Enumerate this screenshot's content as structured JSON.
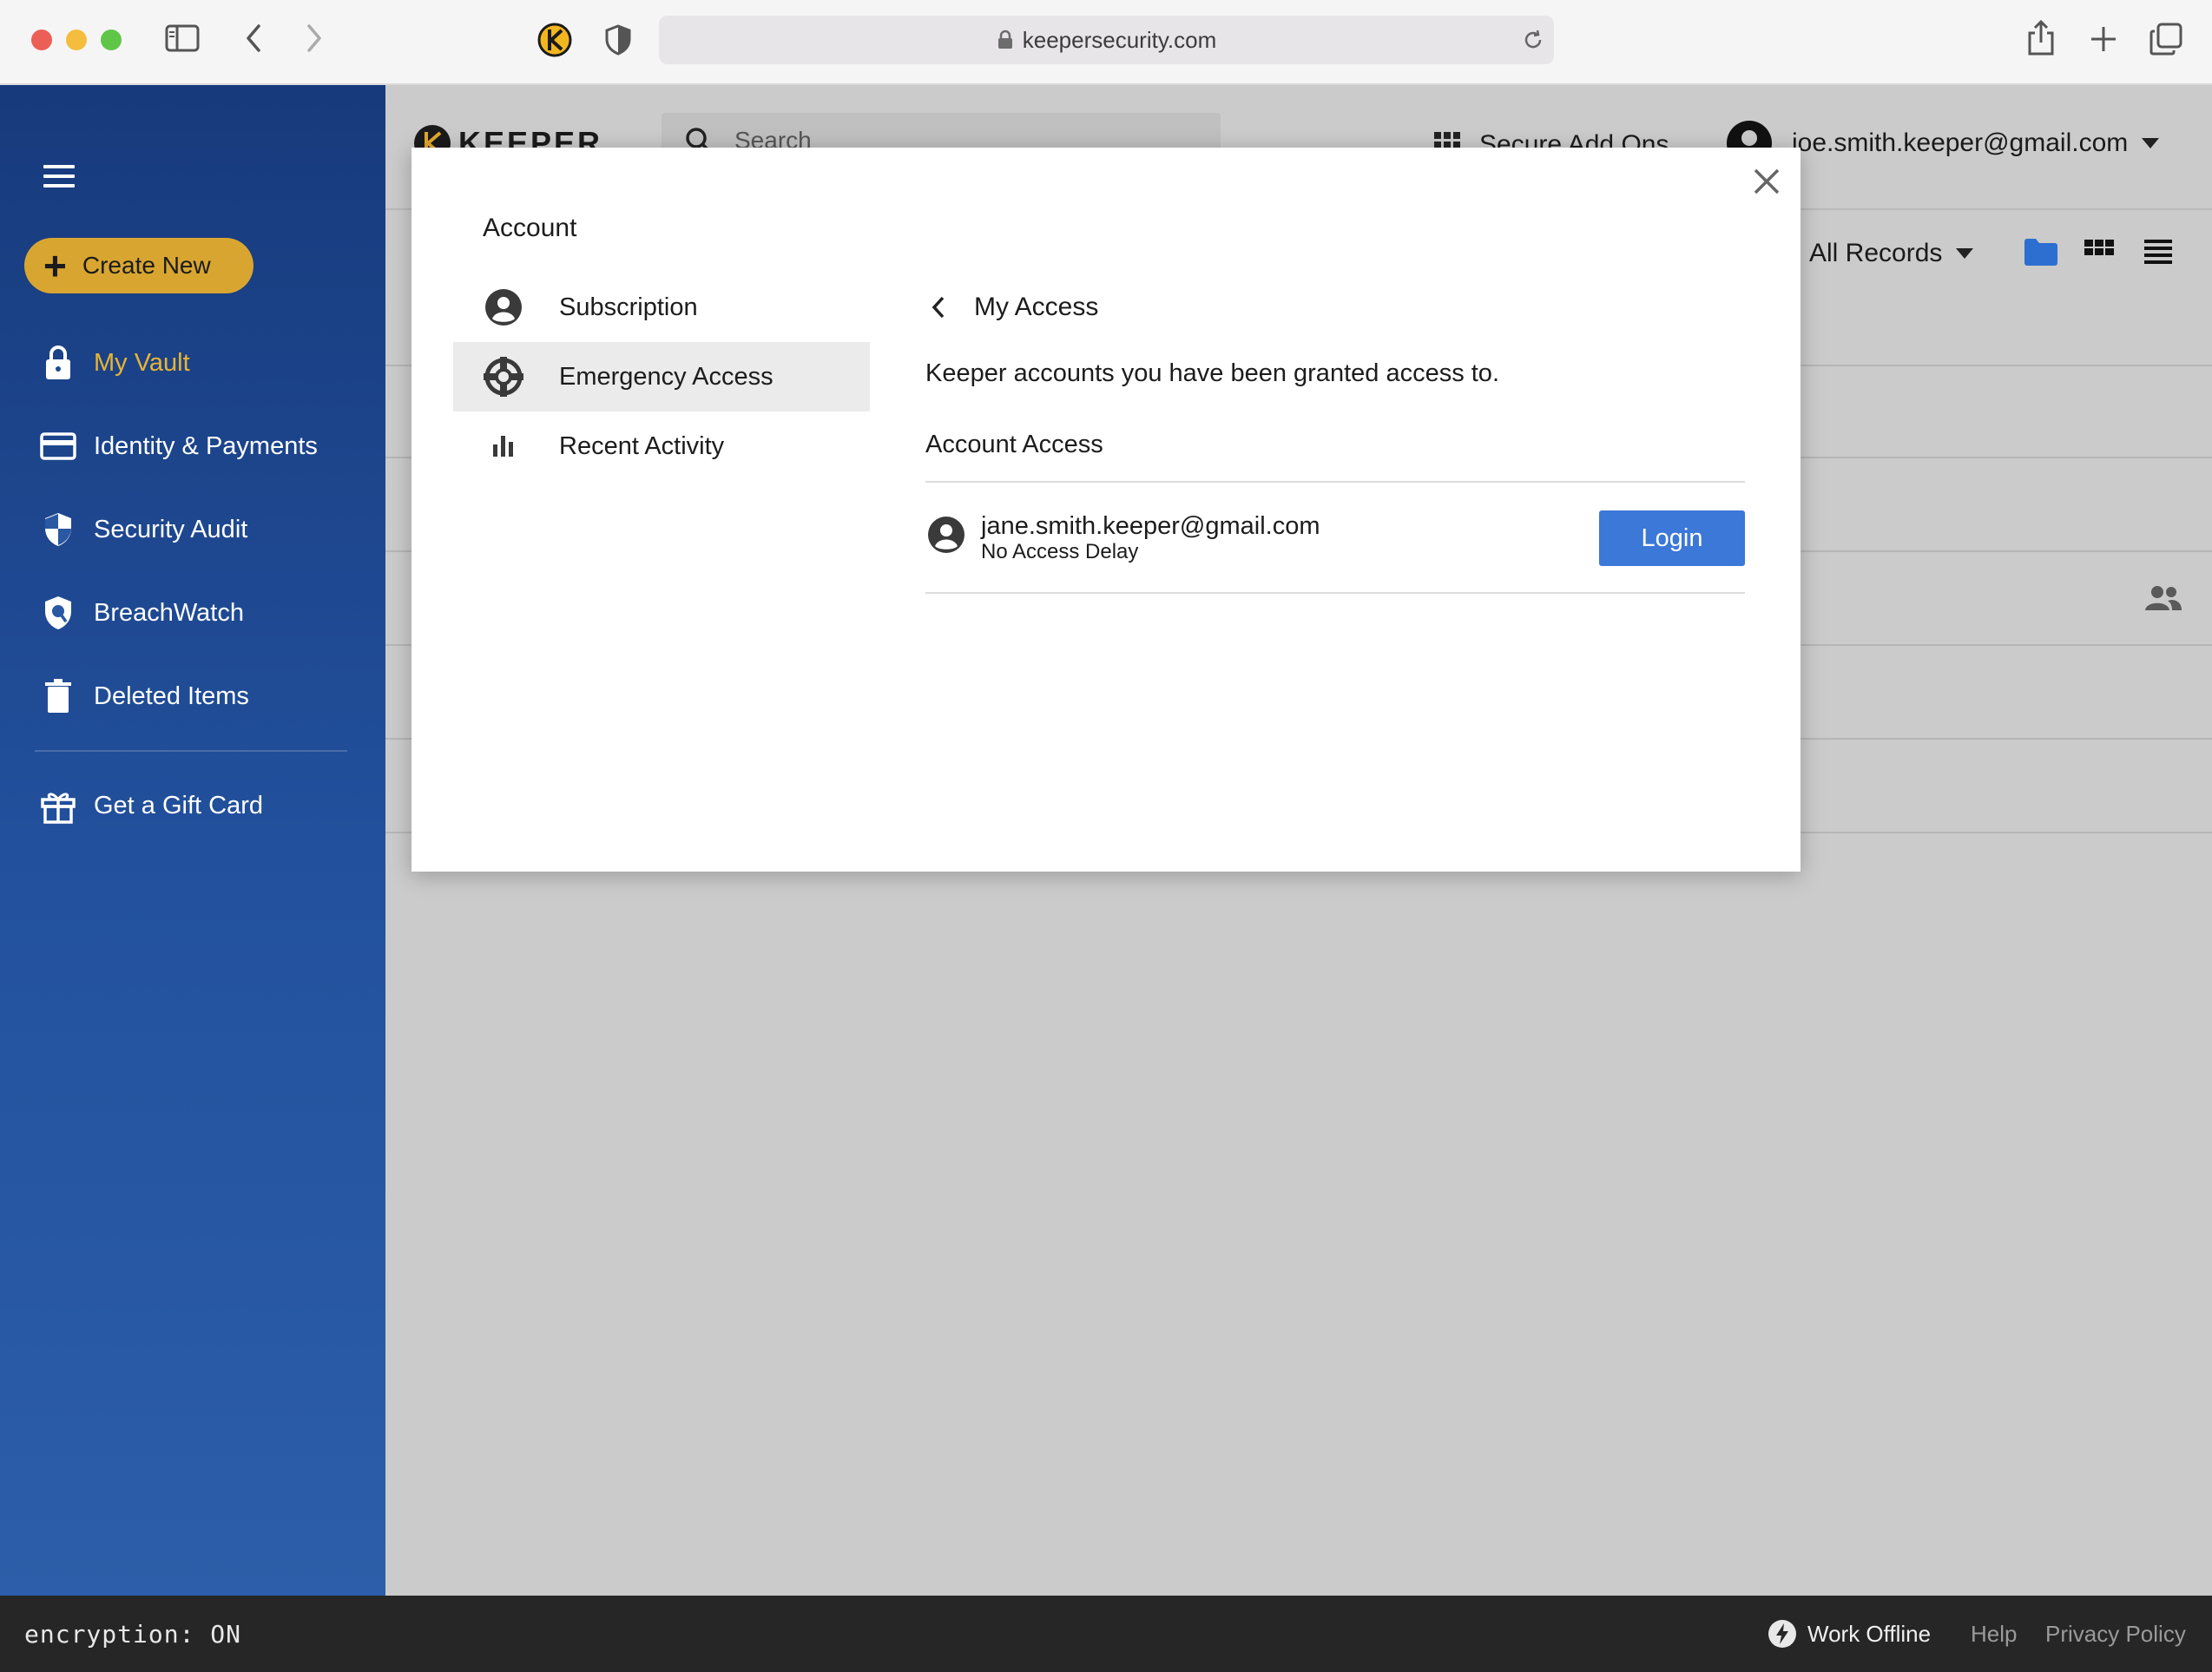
{
  "browser": {
    "url": "keepersecurity.com"
  },
  "sidebar": {
    "create_new": "Create New",
    "items": [
      {
        "label": "My Vault",
        "active": true
      },
      {
        "label": "Identity & Payments"
      },
      {
        "label": "Security Audit"
      },
      {
        "label": "BreachWatch"
      },
      {
        "label": "Deleted Items"
      },
      {
        "label": "Get a Gift Card"
      }
    ]
  },
  "header": {
    "logo_text": "KEEPER",
    "search_placeholder": "Search",
    "secure_addons": "Secure Add Ons",
    "user_email": "joe.smith.keeper@gmail.com",
    "filter": "All Records"
  },
  "modal": {
    "title": "Account",
    "menu": [
      {
        "label": "Subscription",
        "icon": "account-circle-icon"
      },
      {
        "label": "Emergency Access",
        "icon": "lifebuoy-icon",
        "selected": true
      },
      {
        "label": "Recent Activity",
        "icon": "bar-chart-icon"
      }
    ],
    "panel": {
      "heading": "My Access",
      "description": "Keeper accounts you have been granted access to.",
      "section_title": "Account Access",
      "accounts": [
        {
          "email": "jane.smith.keeper@gmail.com",
          "delay": "No Access Delay",
          "action": "Login"
        }
      ]
    }
  },
  "footer": {
    "encryption": "encryption: ON",
    "work_offline": "Work Offline",
    "help": "Help",
    "privacy": "Privacy Policy"
  },
  "colors": {
    "sidebar_top": "#173a7c",
    "sidebar_bottom": "#2c5ea9",
    "accent_gold": "#d8a630",
    "login_blue": "#3b78d8",
    "folder_blue": "#2c6fd1"
  }
}
